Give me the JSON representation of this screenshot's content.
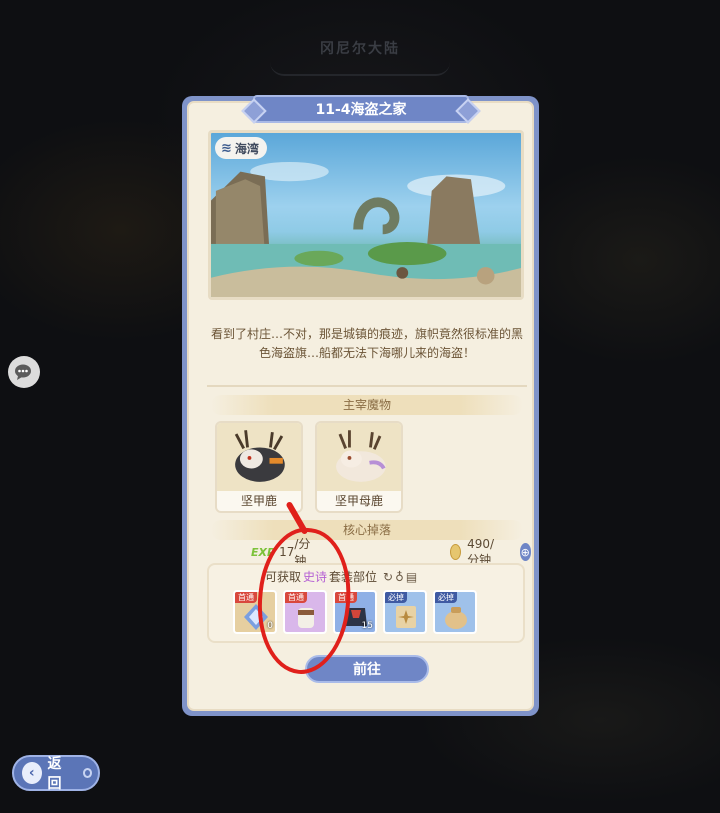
{
  "map": {
    "region_name": "冈尼尔大陆"
  },
  "dialog": {
    "title": "11-4海盗之家",
    "zone_tag": "海湾",
    "description": "看到了村庄…不对，那是城镇的痕迹，旗帜竟然很标准的黑色海盗旗…船都无法下海哪儿来的海盗！",
    "section_monsters": "主宰魔物",
    "monsters": [
      {
        "name": "坚甲鹿"
      },
      {
        "name": "坚甲母鹿"
      }
    ],
    "section_drops": "核心掉落",
    "exp_label": "EXP",
    "exp_rate": "17",
    "exp_rate_suffix": "/分钟",
    "gold_rate": "490/分钟",
    "drop_info": {
      "prefix": "可获取",
      "quality": "史诗",
      "suffix": "套装部位"
    },
    "items": [
      {
        "tag": "首通",
        "tag_type": "first",
        "count": "0",
        "bg": "#e6cfa0"
      },
      {
        "tag": "首通",
        "tag_type": "first",
        "count": "",
        "bg": "#d9b7ea"
      },
      {
        "tag": "首通",
        "tag_type": "first",
        "count": "15",
        "bg": "#8fb0e6"
      },
      {
        "tag": "必掉",
        "tag_type": "must",
        "count": "",
        "bg": "#9fc1ea"
      },
      {
        "tag": "必掉",
        "tag_type": "must",
        "count": "",
        "bg": "#9fc1ea"
      }
    ],
    "go_button": "前往"
  },
  "back_button": "返 回",
  "colors": {
    "accent": "#6f86c6",
    "panel": "#f5efe0",
    "annotation": "#e0201b"
  }
}
